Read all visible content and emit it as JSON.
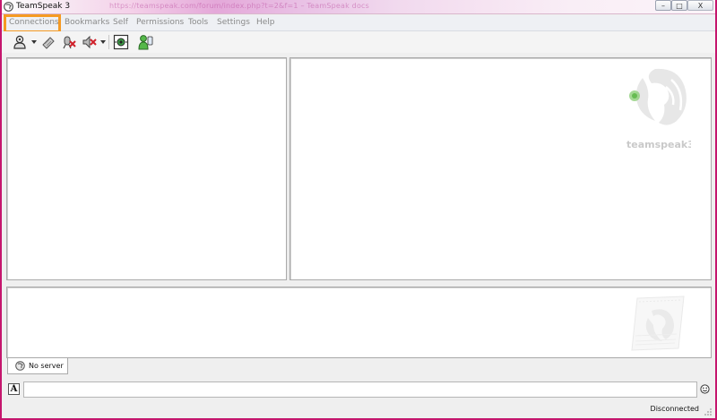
{
  "window": {
    "title": "TeamSpeak 3",
    "background_caption": "https://teamspeak.com/forum/index.php?t=2&f=1 – TeamSpeak docs",
    "minimize_glyph": "–",
    "maximize_glyph": "□",
    "close_glyph": "X"
  },
  "menubar": {
    "items": [
      {
        "label": "Connections",
        "highlighted": true
      },
      {
        "label": "Bookmarks"
      },
      {
        "label": "Self"
      },
      {
        "label": "Permissions"
      },
      {
        "label": "Tools"
      },
      {
        "label": "Settings"
      },
      {
        "label": "Help"
      }
    ],
    "highlight_color": "#f59a23"
  },
  "toolbar": {
    "buttons": [
      {
        "name": "connect-icon",
        "has_dropdown": true
      },
      {
        "name": "disconnect-icon"
      },
      {
        "name": "mute-microphone-icon"
      },
      {
        "name": "mute-speakers-icon",
        "has_dropdown": true
      },
      {
        "name": "subscribe-channel-icon"
      },
      {
        "name": "away-status-icon"
      }
    ]
  },
  "info_panel": {
    "logo_text": "teamspeak3"
  },
  "tabs": [
    {
      "label": "No server",
      "icon": "server-tab-icon",
      "active": true
    }
  ],
  "chat_input": {
    "value": "",
    "format_button_label": "A"
  },
  "status": {
    "text": "Disconnected"
  },
  "colors": {
    "window_border": "#c5166d",
    "titlebar_accent": "#e4a8d9",
    "menu_text": "#8a8a8a"
  }
}
